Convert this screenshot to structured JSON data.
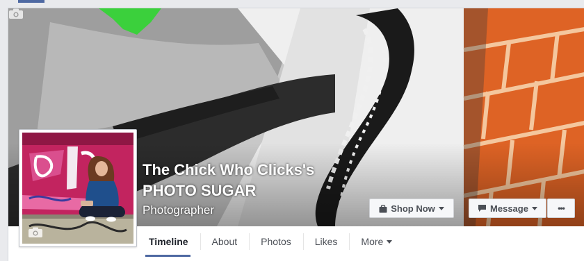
{
  "page": {
    "name_line1": "The Chick Who Clicks's",
    "name_line2": "PHOTO SUGAR",
    "category": "Photographer"
  },
  "actions": {
    "shop_label": "Shop Now",
    "message_label": "Message",
    "more_label": "•••"
  },
  "nav": {
    "tabs": [
      {
        "label": "Timeline",
        "active": true
      },
      {
        "label": "About"
      },
      {
        "label": "Photos"
      },
      {
        "label": "Likes"
      },
      {
        "label": "More"
      }
    ]
  },
  "colors": {
    "accent": "#4e69a2",
    "brick": "#e0662a",
    "profile_wall": "#c2245f"
  },
  "icons": {
    "cover_camera": "camera-icon",
    "profile_camera": "camera-icon",
    "shop": "shopping-bag-icon",
    "message": "speech-bubble-icon"
  }
}
